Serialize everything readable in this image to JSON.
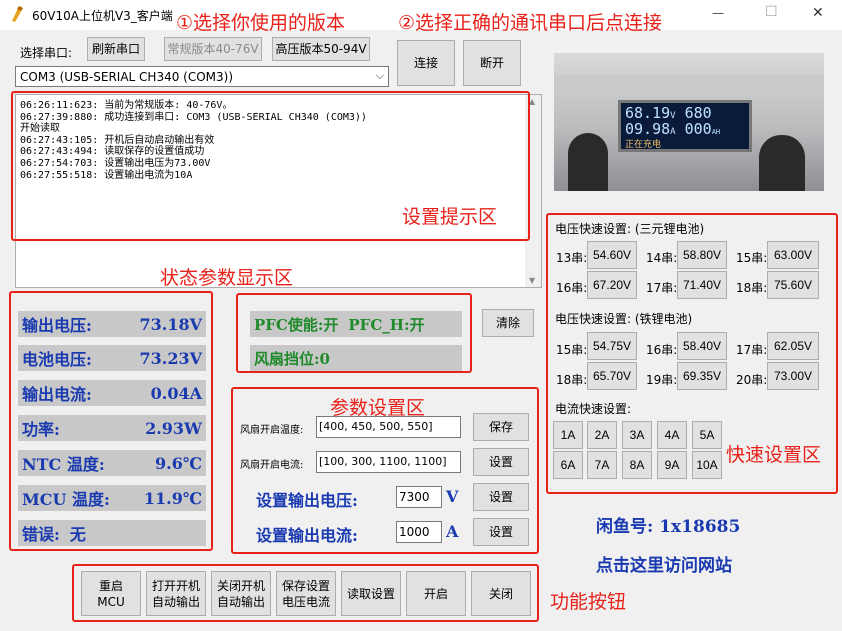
{
  "window": {
    "title": "60V10A上位机V3_客户端",
    "controls": {
      "minimize": "—",
      "maximize": "☐",
      "close": "✕"
    }
  },
  "annotations": {
    "step1": "①选择你使用的版本",
    "step2": "②选择正确的通讯串口后点连接",
    "log_area": "设置提示区",
    "status_area": "状态参数显示区",
    "param_area": "参数设置区",
    "quick_area": "快速设置区",
    "func_area": "功能按钮"
  },
  "serial": {
    "label": "选择串口:",
    "refresh": "刷新串口",
    "normal_version": "常规版本40-76V",
    "high_version": "高压版本50-94V",
    "port_value": "COM3 (USB-SERIAL CH340 (COM3))",
    "connect": "连接",
    "disconnect": "断开"
  },
  "log": {
    "lines": [
      "06:26:11:623: 当前为常规版本: 40-76V。",
      "06:27:39:880: 成功连接到串口: COM3 (USB-SERIAL CH340 (COM3))",
      "开始读取",
      "06:27:43:105: 开机后自动启动输出有效",
      "06:27:43:494: 读取保存的设置值成功",
      "06:27:54:703: 设置输出电压为73.00V",
      "06:27:55:518: 设置输出电流为10A"
    ]
  },
  "device_photo": {
    "line1_value": "68.19",
    "line1_unit": "V",
    "line1_value2": "680",
    "line2_value": "09.98",
    "line2_unit": "A",
    "line2_value2": "000",
    "line2_unit2": "AH",
    "line3": "正在充电"
  },
  "status": {
    "output_voltage": {
      "label": "输出电压:",
      "value": "73.18V"
    },
    "battery_voltage": {
      "label": "电池电压:",
      "value": "73.23V"
    },
    "output_current": {
      "label": "输出电流:",
      "value": "0.04A"
    },
    "power": {
      "label": "功率:",
      "value": "2.93W"
    },
    "ntc_temp": {
      "label": "NTC 温度:",
      "value": "9.6℃"
    },
    "mcu_temp": {
      "label": "MCU 温度:",
      "value": "11.9℃"
    },
    "error": {
      "label": "错误:",
      "value": "无"
    }
  },
  "pfc": {
    "pfc_enable": "PFC使能:开",
    "pfc_h": "PFC_H:开",
    "fan_level": "风扇挡位:0",
    "clear": "清除"
  },
  "params": {
    "fan_temp_label": "风扇开启温度:",
    "fan_temp_value": "[400, 450, 500, 550]",
    "fan_temp_button": "保存",
    "fan_current_label": "风扇开启电流:",
    "fan_current_value": "[100, 300, 1100, 1100]",
    "fan_current_button": "设置",
    "voltage_label": "设置输出电压:",
    "voltage_value": "7300",
    "voltage_unit": "V",
    "voltage_button": "设置",
    "current_label": "设置输出电流:",
    "current_value": "1000",
    "current_unit": "A",
    "current_button": "设置"
  },
  "quick": {
    "ternary_title": "电压快速设置: (三元锂电池)",
    "ternary": [
      {
        "label": "13串:",
        "value": "54.60V"
      },
      {
        "label": "14串:",
        "value": "58.80V"
      },
      {
        "label": "15串:",
        "value": "63.00V"
      },
      {
        "label": "16串:",
        "value": "67.20V"
      },
      {
        "label": "17串:",
        "value": "71.40V"
      },
      {
        "label": "18串:",
        "value": "75.60V"
      }
    ],
    "lfp_title": "电压快速设置: (铁锂电池)",
    "lfp": [
      {
        "label": "15串:",
        "value": "54.75V"
      },
      {
        "label": "16串:",
        "value": "58.40V"
      },
      {
        "label": "17串:",
        "value": "62.05V"
      },
      {
        "label": "18串:",
        "value": "65.70V"
      },
      {
        "label": "19串:",
        "value": "69.35V"
      },
      {
        "label": "20串:",
        "value": "73.00V"
      }
    ],
    "current_title": "电流快速设置:",
    "currents": [
      "1A",
      "2A",
      "3A",
      "4A",
      "5A",
      "6A",
      "7A",
      "8A",
      "9A",
      "10A"
    ]
  },
  "footer": {
    "xianyu": "闲鱼号: 1x18685",
    "website": "点击这里访问网站"
  },
  "functions": {
    "restart_mcu": "重启\nMCU",
    "enable_auto": "打开开机\n自动输出",
    "disable_auto": "关闭开机\n自动输出",
    "save_vi": "保存设置\n电压电流",
    "read_settings": "读取设置",
    "turn_on": "开启",
    "turn_off": "关闭"
  }
}
